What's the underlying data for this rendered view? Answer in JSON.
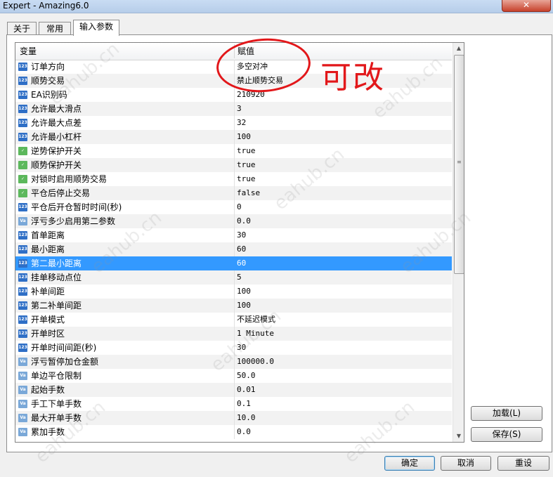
{
  "window": {
    "title": "Expert - Amazing6.0",
    "close_icon": "close-icon"
  },
  "tabs": [
    {
      "label": "关于"
    },
    {
      "label": "常用"
    },
    {
      "label": "输入参数"
    }
  ],
  "grid": {
    "headers": {
      "variable": "变量",
      "value": "赋值"
    },
    "rows": [
      {
        "type": "int",
        "label": "订单方向",
        "value": "多空对冲"
      },
      {
        "type": "int",
        "label": "顺势交易",
        "value": "禁止顺势交易"
      },
      {
        "type": "int",
        "label": "EA识别码",
        "value": "210920"
      },
      {
        "type": "int",
        "label": "允许最大滑点",
        "value": "3"
      },
      {
        "type": "int",
        "label": "允许最大点差",
        "value": "32"
      },
      {
        "type": "int",
        "label": "允许最小杠杆",
        "value": "100"
      },
      {
        "type": "bool",
        "label": "逆势保护开关",
        "value": "true"
      },
      {
        "type": "bool",
        "label": "顺势保护开关",
        "value": "true"
      },
      {
        "type": "bool",
        "label": "对锁时启用顺势交易",
        "value": "true"
      },
      {
        "type": "bool",
        "label": "平仓后停止交易",
        "value": "false"
      },
      {
        "type": "int",
        "label": "平仓后开仓暂时时间(秒)",
        "value": "0"
      },
      {
        "type": "dbl",
        "label": "浮亏多少启用第二参数",
        "value": "0.0"
      },
      {
        "type": "int",
        "label": "首单距离",
        "value": "30"
      },
      {
        "type": "int",
        "label": "最小距离",
        "value": "60"
      },
      {
        "type": "int",
        "label": "第二最小距离",
        "value": "60",
        "selected": true
      },
      {
        "type": "int",
        "label": "挂单移动点位",
        "value": "5"
      },
      {
        "type": "int",
        "label": "补单间距",
        "value": "100"
      },
      {
        "type": "int",
        "label": "第二补单间距",
        "value": "100"
      },
      {
        "type": "int",
        "label": "开单模式",
        "value": "不延迟模式"
      },
      {
        "type": "int",
        "label": "开单时区",
        "value": "1 Minute"
      },
      {
        "type": "int",
        "label": "开单时间间距(秒)",
        "value": "30"
      },
      {
        "type": "dbl",
        "label": "浮亏暂停加仓金额",
        "value": "100000.0"
      },
      {
        "type": "dbl",
        "label": "单边平仓限制",
        "value": "50.0"
      },
      {
        "type": "dbl",
        "label": "起始手数",
        "value": "0.01"
      },
      {
        "type": "dbl",
        "label": "手工下单手数",
        "value": "0.1"
      },
      {
        "type": "dbl",
        "label": "最大开单手数",
        "value": "10.0"
      },
      {
        "type": "dbl",
        "label": "累加手数",
        "value": "0.0"
      }
    ]
  },
  "side_buttons": {
    "load": "加载(L)",
    "save": "保存(S)"
  },
  "footer_buttons": {
    "ok": "确定",
    "cancel": "取消",
    "reset": "重设"
  },
  "annotation": {
    "text": "可改"
  },
  "watermark": {
    "text": "eahub.cn"
  },
  "colors": {
    "selection": "#3399ff",
    "annotation": "#e2171a"
  }
}
